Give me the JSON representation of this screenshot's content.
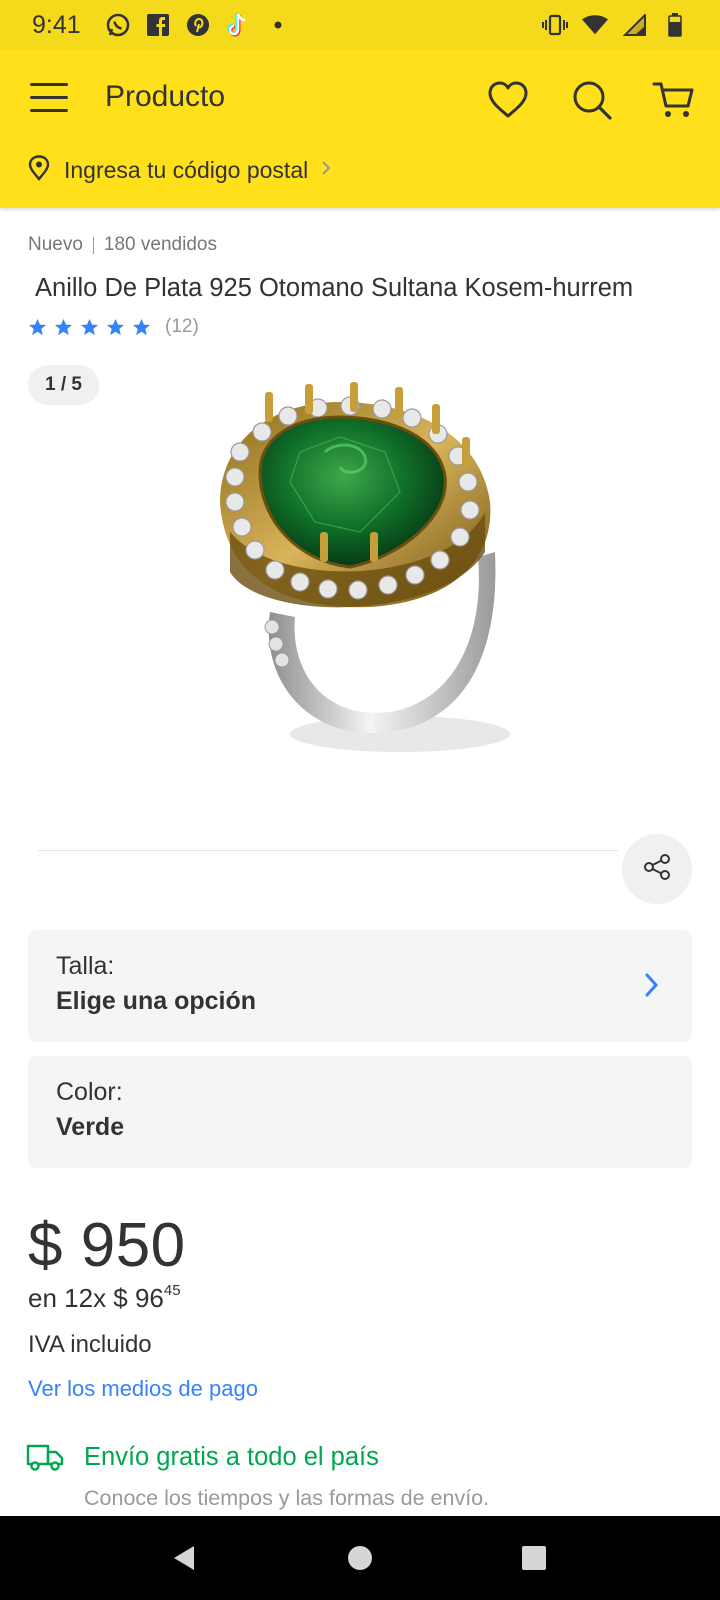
{
  "status_bar": {
    "time": "9:41",
    "left_icons": [
      "whatsapp-icon",
      "facebook-icon",
      "pinterest-icon",
      "tiktok-icon",
      "notification-dot-icon"
    ],
    "right_icons": [
      "vibrate-icon",
      "wifi-icon",
      "signal-icon",
      "battery-icon"
    ]
  },
  "header": {
    "title": "Producto",
    "postal_prompt": "Ingresa tu código postal",
    "brand_color": "#ffe01a"
  },
  "product": {
    "condition": "Nuevo",
    "sold": "180 vendidos",
    "title": "Anillo De Plata 925 Otomano Sultana Kosem-hurrem",
    "rating": 5,
    "review_count": "(12)",
    "image_counter": "1 / 5"
  },
  "variants": {
    "size_label": "Talla:",
    "size_value": "Elige una opción",
    "color_label": "Color:",
    "color_value": "Verde"
  },
  "price": {
    "main": "$ 950",
    "installments_prefix": "en 12x $ 96",
    "installments_cents": "45",
    "tax_note": "IVA incluido",
    "payment_link": "Ver los medios de pago"
  },
  "shipping": {
    "title": "Envío gratis a todo el país",
    "subtitle": "Conoce los tiempos y las formas de envío.",
    "color": "#00a650"
  },
  "colors": {
    "link": "#3483fa",
    "star": "#3483fa"
  }
}
